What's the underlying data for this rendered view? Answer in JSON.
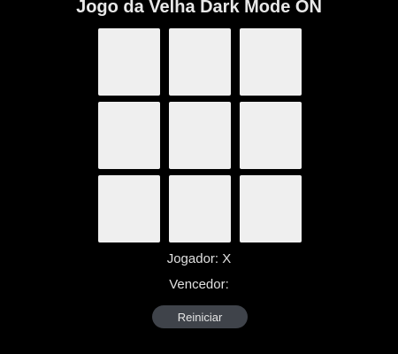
{
  "header": {
    "title": "Jogo da Velha Dark Mode ON"
  },
  "board": {
    "cells": [
      "",
      "",
      "",
      "",
      "",
      "",
      "",
      "",
      ""
    ]
  },
  "status": {
    "player_label": "Jogador:",
    "player_value": "X",
    "winner_label": "Vencedor:",
    "winner_value": ""
  },
  "controls": {
    "restart_label": "Reiniciar"
  },
  "colors": {
    "background": "#000000",
    "cell": "#efefef",
    "button": "#3f434a",
    "text": "#e6e6e6"
  }
}
